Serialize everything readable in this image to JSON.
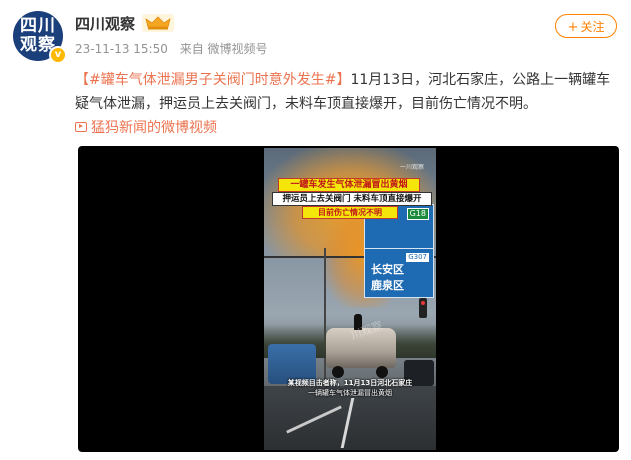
{
  "user": {
    "avatar_line1": "四川",
    "avatar_line2": "观察",
    "name": "四川观察",
    "verified_mark": "v",
    "badge_icon": "crown-icon"
  },
  "meta": {
    "time": "23-11-13 15:50",
    "source": "来自 微博视频号"
  },
  "follow": {
    "label": "关注",
    "plus": "+"
  },
  "post": {
    "topic": "【#罐车气体泄漏男子关阀门时意外发生#】",
    "text": "11月13日，河北石家庄，公路上一辆罐车疑气体泄漏，押运员上去关阀门，未料车顶直接爆开，目前伤亡情况不明。",
    "source_link": "猛犸新闻的微博视频"
  },
  "video": {
    "watermark_top": "一川观察",
    "caption1": "一罐车发生气体泄漏冒出黄烟",
    "caption2": "押运员上去关阀门 未料车顶直接爆开",
    "caption3": "目前伤亡情况不明",
    "sign_route": "G18",
    "sign_road": "G307",
    "district1": "长安区",
    "district2": "鹿泉区",
    "watermark_mid": "川观察",
    "subtitle1": "某视频目击者称，11月13日河北石家庄",
    "subtitle2": "一辆罐车气体泄漏冒出黄烟"
  },
  "colors": {
    "accent": "#ff8200",
    "topic": "#eb7350",
    "gas": "#eca028"
  }
}
